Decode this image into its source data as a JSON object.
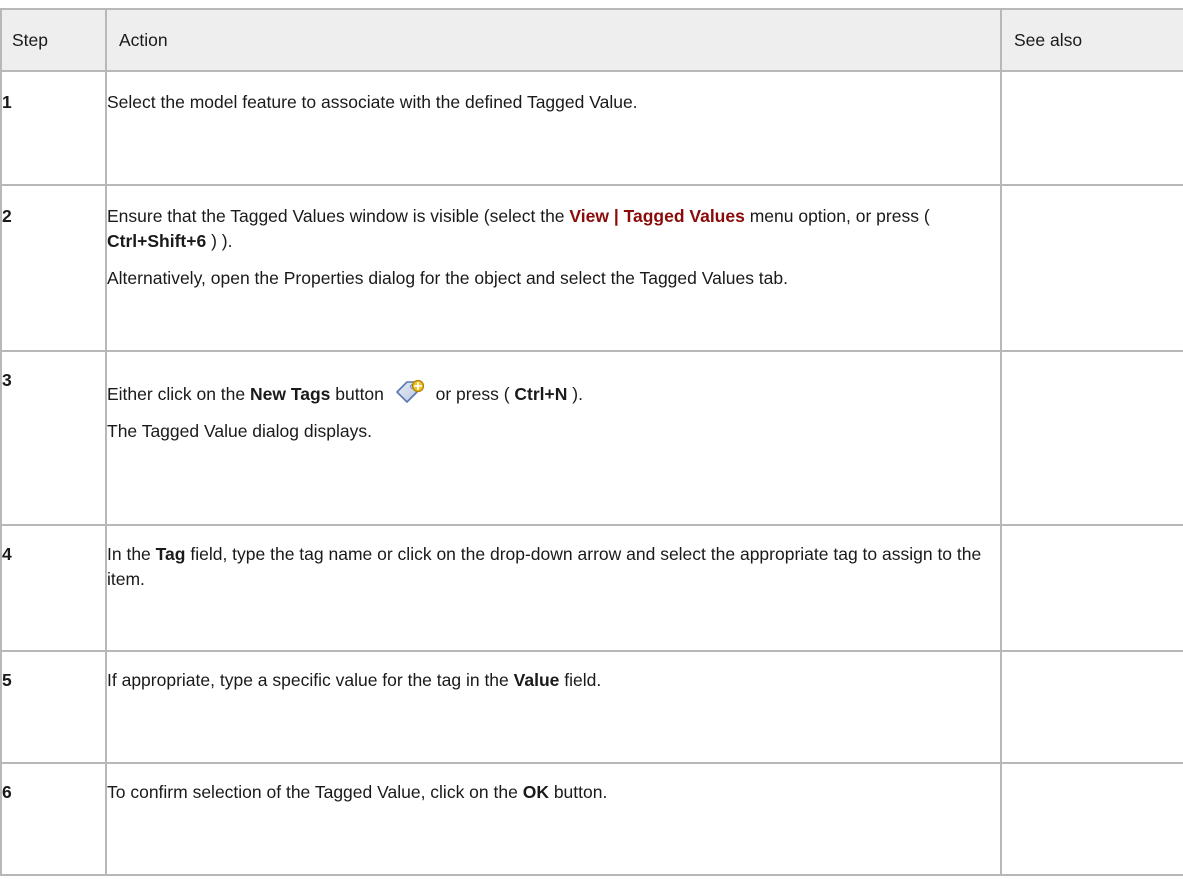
{
  "table": {
    "headers": {
      "step": "Step",
      "action": "Action",
      "see_also": "See also"
    },
    "rows": [
      {
        "step": "1",
        "text": "Select the model feature to associate with the defined Tagged Value."
      },
      {
        "step": "2",
        "pre": "Ensure that the Tagged Values window is visible (select the ",
        "menu": "View | Tagged Values",
        "mid": " menu option, or press ( ",
        "shortcut": "Ctrl+Shift+6",
        "post": " ) ).",
        "para2": "Alternatively, open the Properties dialog for the object and select the Tagged Values tab."
      },
      {
        "step": "3",
        "pre": "Either click on the ",
        "button": "New Tags",
        "mid": " button ",
        "icon": "new-tags-icon",
        "mid2": " or press ( ",
        "shortcut": "Ctrl+N",
        "post": " ).",
        "para2": "The Tagged Value dialog displays."
      },
      {
        "step": "4",
        "pre": "In the ",
        "field": "Tag",
        "post": " field, type the tag name or click on the drop-down arrow and select the appropriate tag to assign to the item."
      },
      {
        "step": "5",
        "pre": "If appropriate, type a specific value for the tag in the ",
        "field": "Value",
        "post": " field."
      },
      {
        "step": "6",
        "pre": "To confirm selection of the Tagged Value, click on the ",
        "button": "OK",
        "post": " button."
      }
    ]
  },
  "colors": {
    "link": "#8b0a0a",
    "border": "#b8b8b8",
    "header_bg": "#eeeeee"
  }
}
